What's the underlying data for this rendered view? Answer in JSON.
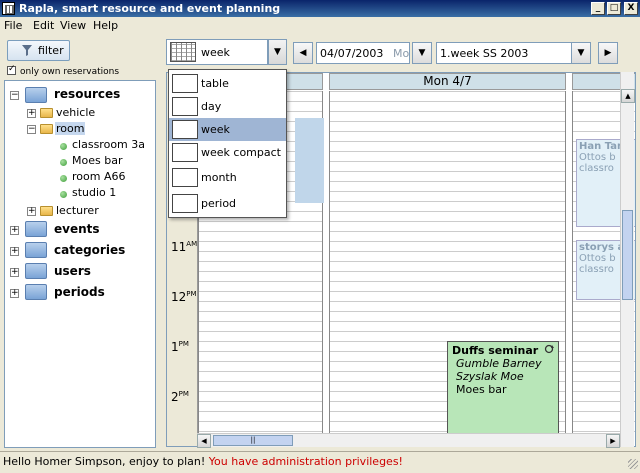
{
  "window": {
    "title": "Rapla, smart resource and event planning",
    "controls": {
      "minimize": "_",
      "maximize": "□",
      "close": "X"
    }
  },
  "menu": [
    {
      "label": "File",
      "mnemonic": "F"
    },
    {
      "label": "Edit",
      "mnemonic": "E"
    },
    {
      "label": "View",
      "mnemonic": "V"
    },
    {
      "label": "Help",
      "mnemonic": "H"
    }
  ],
  "left": {
    "filter_label": "filter",
    "only_own": "only own reservations",
    "only_own_checked": true,
    "tree": {
      "resources": "resources",
      "vehicle": "vehicle",
      "room": "room",
      "rooms": [
        "classroom 3a",
        "Moes bar",
        "room A66",
        "studio 1"
      ],
      "lecturer": "lecturer",
      "events": "events",
      "categories": "categories",
      "users": "users",
      "periods": "periods"
    }
  },
  "toolbar": {
    "view_selected": "week",
    "date": "04/07/2003",
    "date_suffix": "Mo",
    "period": "1.week SS 2003",
    "prev_icon": "◀",
    "next_icon": "▶",
    "dropdown_icon": "▼"
  },
  "view_menu": {
    "items": [
      "table",
      "day",
      "week",
      "week compact",
      "month",
      "period"
    ],
    "selected": "week"
  },
  "calendar": {
    "day_header": "Mon 4/7",
    "hours": [
      {
        "h": "11",
        "ampm": "AM"
      },
      {
        "h": "12",
        "ampm": "PM"
      },
      {
        "h": "1",
        "ampm": "PM"
      },
      {
        "h": "2",
        "ampm": "PM"
      }
    ],
    "event": {
      "name": "Duffs seminar",
      "persons": [
        "Gumble Barney",
        "Szyslak Moe"
      ],
      "room": "Moes bar"
    },
    "ghost_events": [
      {
        "name": "Han Tan",
        "lines": [
          "Ottos b",
          "classro"
        ]
      },
      {
        "name": "storys a",
        "lines": [
          "Ottos b",
          "classro"
        ]
      }
    ],
    "hscroll_thumb": "||"
  },
  "status": {
    "greeting": "Hello Homer Simpson, enjoy to plan!",
    "admin_notice": "You have administration privileges!"
  },
  "colors": {
    "event_bg": "#b8e6b8",
    "day_header_bg": "#cfe0e8",
    "selection": "#9fb5d4",
    "admin_text": "#cc0000"
  }
}
